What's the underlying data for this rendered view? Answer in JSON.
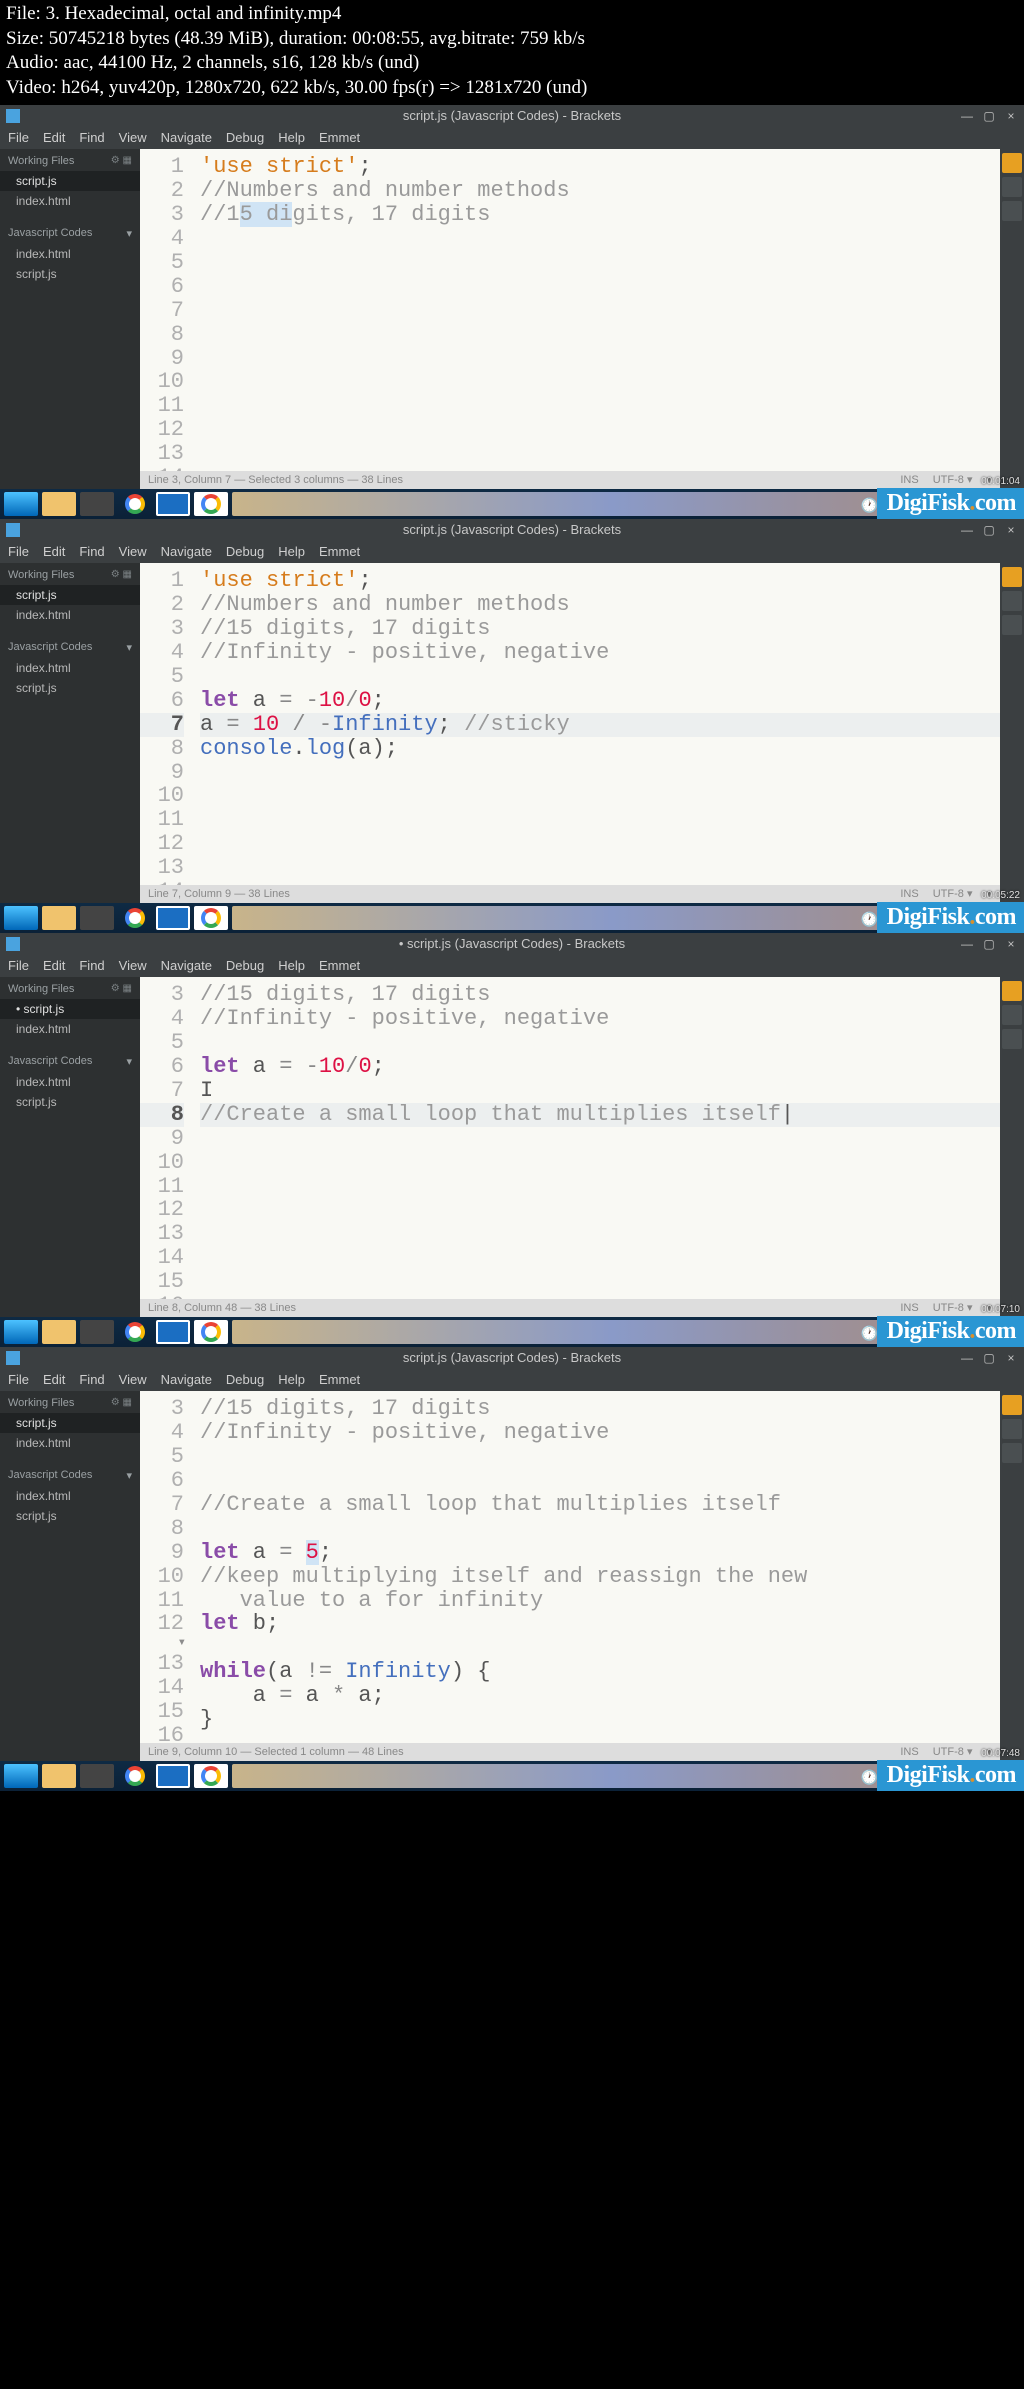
{
  "fileinfo": {
    "l1": "File: 3. Hexadecimal, octal and infinity.mp4",
    "l2": "Size: 50745218 bytes (48.39 MiB), duration: 00:08:55, avg.bitrate: 759 kb/s",
    "l3": "Audio: aac, 44100 Hz, 2 channels, s16, 128 kb/s (und)",
    "l4": "Video: h264, yuv420p, 1280x720, 622 kb/s, 30.00 fps(r) => 1281x720 (und)"
  },
  "app": {
    "title_normal": "script.js (Javascript Codes) - Brackets",
    "title_unsaved": "• script.js (Javascript Codes) - Brackets"
  },
  "menu": {
    "items": [
      "File",
      "Edit",
      "Find",
      "View",
      "Navigate",
      "Debug",
      "Help",
      "Emmet"
    ]
  },
  "sidebar": {
    "working_hdr": "Working Files",
    "working": [
      {
        "name": "script.js",
        "active": true
      },
      {
        "name": "index.html",
        "active": false
      }
    ],
    "project_hdr": "Javascript Codes ",
    "project": [
      {
        "name": "index.html"
      },
      {
        "name": "script.js"
      }
    ]
  },
  "status": {
    "p1": {
      "left": "Line 3, Column 7 — Selected 3 columns — 38 Lines",
      "ins": "INS",
      "enc": "UTF-8 ▾",
      "lang": "▾"
    },
    "p2": {
      "left": "Line 7, Column 9 — 38 Lines",
      "ins": "INS",
      "enc": "UTF-8 ▾",
      "lang": "▾"
    },
    "p3": {
      "left": "Line 8, Column 48 — 38 Lines",
      "ins": "INS",
      "enc": "UTF-8 ▾",
      "lang": "▾"
    },
    "p4": {
      "left": "Line 9, Column 10 — Selected 1 column — 48 Lines",
      "ins": "INS",
      "enc": "UTF-8 ▾",
      "lang": "▾"
    }
  },
  "timestamps": {
    "t1": "00:01:04",
    "t2": "00:05:22",
    "t3": "00:07:10",
    "t4": "00:07:48"
  },
  "code": {
    "p1": {
      "start": 1,
      "lines": [
        [
          {
            "t": "'use strict'",
            "c": "str"
          },
          {
            "t": ";"
          }
        ],
        [
          {
            "t": "//Numbers and number methods",
            "c": "cmt"
          }
        ],
        [
          {
            "t": "//1",
            "c": "cmt"
          },
          {
            "t": "5 di",
            "c": "cmt hl"
          },
          {
            "t": "gits, 17 digits",
            "c": "cmt"
          }
        ],
        [],
        [],
        [],
        [],
        [],
        [],
        [],
        [],
        [],
        [],
        [],
        []
      ]
    },
    "p2": {
      "start": 1,
      "highlight": 7,
      "lines": [
        [
          {
            "t": "'use strict'",
            "c": "str"
          },
          {
            "t": ";"
          }
        ],
        [
          {
            "t": "//Numbers and number methods",
            "c": "cmt"
          }
        ],
        [
          {
            "t": "//15 digits, 17 digits",
            "c": "cmt"
          }
        ],
        [
          {
            "t": "//Infinity - positive, negative",
            "c": "cmt"
          }
        ],
        [],
        [
          {
            "t": "let",
            "c": "kw"
          },
          {
            "t": " a "
          },
          {
            "t": "=",
            "c": "op"
          },
          {
            "t": " "
          },
          {
            "t": "-",
            "c": "op"
          },
          {
            "t": "10",
            "c": "num"
          },
          {
            "t": "/",
            "c": "op"
          },
          {
            "t": "0",
            "c": "num"
          },
          {
            "t": ";"
          }
        ],
        [
          {
            "t": "a "
          },
          {
            "t": "=",
            "c": "op"
          },
          {
            "t": " "
          },
          {
            "t": "10",
            "c": "num"
          },
          {
            "t": " "
          },
          {
            "t": "/",
            "c": "op"
          },
          {
            "t": " "
          },
          {
            "t": "-",
            "c": "op"
          },
          {
            "t": "Infinity",
            "c": "var"
          },
          {
            "t": "; "
          },
          {
            "t": "//sticky",
            "c": "cmt"
          }
        ],
        [
          {
            "t": "console",
            "c": "var"
          },
          {
            "t": "."
          },
          {
            "t": "log",
            "c": "fn"
          },
          {
            "t": "(a);"
          }
        ],
        [],
        [],
        [],
        [],
        [],
        [],
        []
      ]
    },
    "p3": {
      "start": 3,
      "highlight": 8,
      "unsaved_sidebar": true,
      "lines": [
        [
          {
            "t": "//15 digits, 17 digits",
            "c": "cmt"
          }
        ],
        [
          {
            "t": "//Infinity - positive, negative",
            "c": "cmt"
          }
        ],
        [],
        [
          {
            "t": "let",
            "c": "kw"
          },
          {
            "t": " a "
          },
          {
            "t": "=",
            "c": "op"
          },
          {
            "t": " "
          },
          {
            "t": "-",
            "c": "op"
          },
          {
            "t": "10",
            "c": "num"
          },
          {
            "t": "/",
            "c": "op"
          },
          {
            "t": "0",
            "c": "num"
          },
          {
            "t": ";"
          }
        ],
        [
          {
            "t": "I"
          }
        ],
        [
          {
            "t": "//Create a small loop that multiplies itself",
            "c": "cmt"
          },
          {
            "t": "|"
          }
        ],
        [],
        [],
        [],
        [],
        [],
        [],
        [],
        [],
        []
      ]
    },
    "p4": {
      "start": 3,
      "arrow": 13,
      "lines": [
        [
          {
            "t": "//15 digits, 17 digits",
            "c": "cmt"
          }
        ],
        [
          {
            "t": "//Infinity - positive, negative",
            "c": "cmt"
          }
        ],
        [],
        [],
        [
          {
            "t": "//Create a small loop that multiplies itself",
            "c": "cmt"
          }
        ],
        [],
        [
          {
            "t": "let",
            "c": "kw"
          },
          {
            "t": " a "
          },
          {
            "t": "=",
            "c": "op"
          },
          {
            "t": " "
          },
          {
            "t": "5",
            "c": "num hl"
          },
          {
            "t": ";"
          }
        ],
        [
          {
            "t": "//keep multiplying itself and reassign the new",
            "c": "cmt"
          }
        ],
        [
          {
            "t": "   value to a for infinity",
            "c": "cmt"
          }
        ],
        [
          {
            "t": "let",
            "c": "kw"
          },
          {
            "t": " b;"
          }
        ],
        [],
        [
          {
            "t": "while",
            "c": "kw"
          },
          {
            "t": "(a "
          },
          {
            "t": "!=",
            "c": "op"
          },
          {
            "t": " "
          },
          {
            "t": "Infinity",
            "c": "var"
          },
          {
            "t": ") {"
          }
        ],
        [
          {
            "t": "    a "
          },
          {
            "t": "=",
            "c": "op"
          },
          {
            "t": " a "
          },
          {
            "t": "*",
            "c": "op"
          },
          {
            "t": " a;"
          }
        ],
        [
          {
            "t": "}"
          }
        ],
        []
      ],
      "indent_10": true
    }
  },
  "watermark": {
    "a": "DigiFisk",
    "b": ".",
    "c": "com"
  }
}
